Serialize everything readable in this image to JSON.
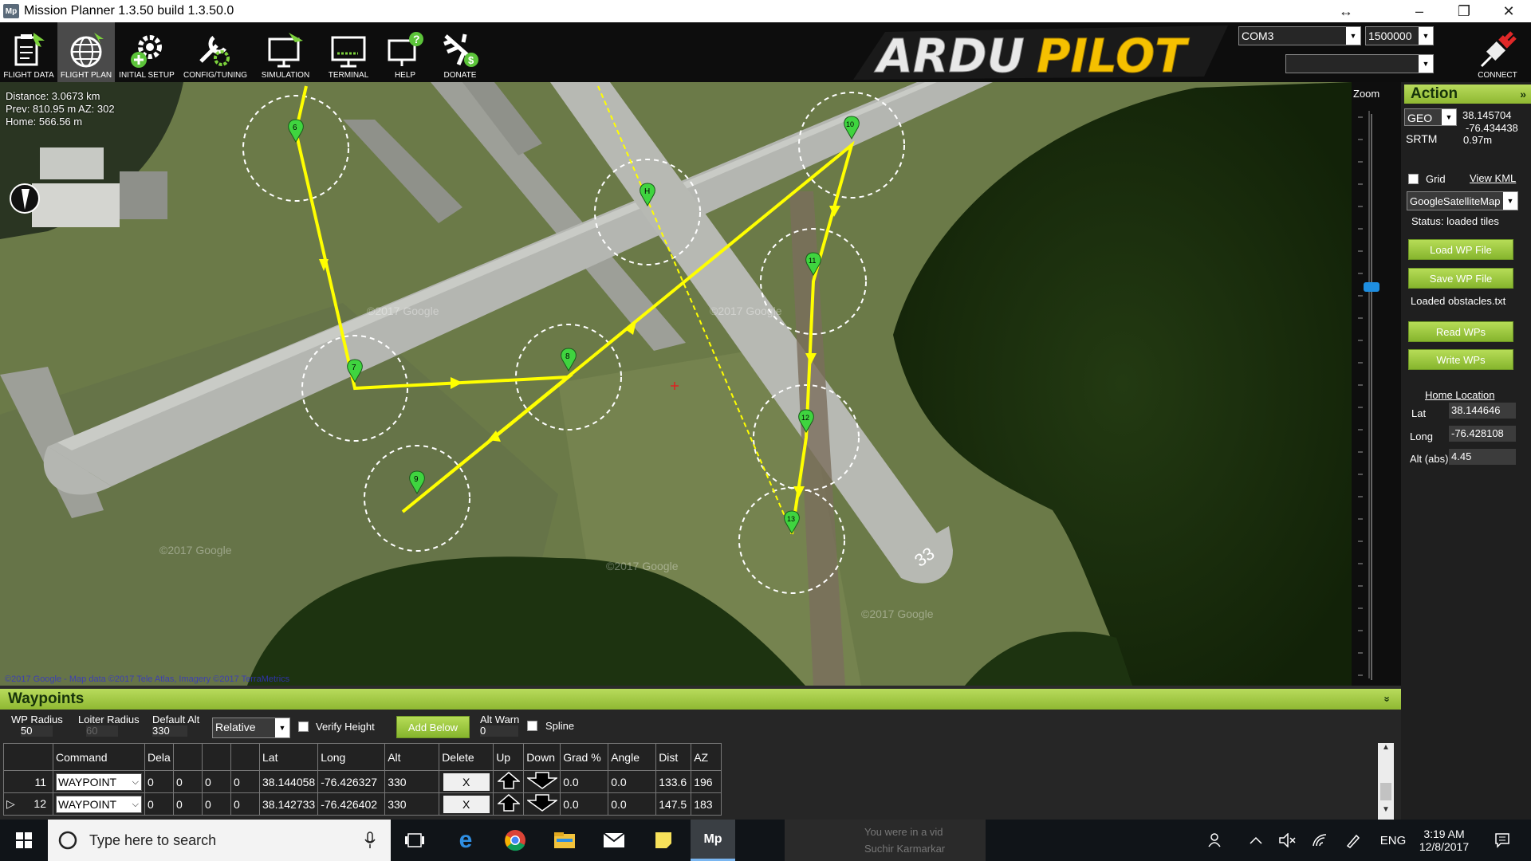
{
  "window": {
    "title": "Mission Planner 1.3.50 build 1.3.50.0",
    "app_icon": "Mp",
    "resize_glyph": "↔",
    "minimize": "–",
    "restore": "❐",
    "close": "✕"
  },
  "toolbar": {
    "buttons": [
      {
        "label": "FLIGHT DATA",
        "icon": "clipboard-plane-icon"
      },
      {
        "label": "FLIGHT PLAN",
        "icon": "globe-icon"
      },
      {
        "label": "INITIAL SETUP",
        "icon": "gear-plus-icon"
      },
      {
        "label": "CONFIG/TUNING",
        "icon": "wrench-gear-icon"
      },
      {
        "label": "SIMULATION",
        "icon": "monitor-plane-icon"
      },
      {
        "label": "TERMINAL",
        "icon": "terminal-icon"
      },
      {
        "label": "HELP",
        "icon": "monitor-question-icon"
      },
      {
        "label": "DONATE",
        "icon": "plane-dollar-icon"
      }
    ],
    "logo_left": "ARDU",
    "logo_right": "PILOT",
    "com_port": "COM3",
    "baud": "1500000",
    "connect_label": "CONNECT"
  },
  "map": {
    "distance": "Distance: 3.0673 km",
    "prev": "Prev: 810.95 m AZ: 302",
    "home": "Home: 566.56 m",
    "copyright": "©2017 Google - Map data ©2017 Tele Atlas, Imagery ©2017 TerraMetrics",
    "watermark": "©2017 Google",
    "runway_number": "33",
    "waypoint_labels": [
      "6",
      "7",
      "8",
      "9",
      "10",
      "11",
      "12",
      "13"
    ],
    "zoom_label": "Zoom"
  },
  "action_panel": {
    "title": "Action",
    "collapse_glyph": "»",
    "coord_mode": "GEO",
    "lat": "38.145704",
    "lng": "-76.434438",
    "srtm_label": "SRTM",
    "srtm_value": "0.97m",
    "grid_label": "Grid",
    "view_kml": "View KML",
    "map_provider": "GoogleSatelliteMap",
    "status": "Status: loaded tiles",
    "load_wp": "Load WP File",
    "save_wp": "Save WP File",
    "obstacles": "Loaded obstacles.txt",
    "read_wps": "Read WPs",
    "write_wps": "Write WPs",
    "home_location": "Home Location",
    "home_lat_label": "Lat",
    "home_lat": "38.144646",
    "home_long_label": "Long",
    "home_long": "-76.428108",
    "home_alt_label": "Alt (abs)",
    "home_alt": "4.45"
  },
  "waypoints": {
    "title": "Waypoints",
    "collapse_glyph": "»",
    "wp_radius_label": "WP Radius",
    "wp_radius": "50",
    "loiter_radius_label": "Loiter Radius",
    "loiter_radius": "60",
    "default_alt_label": "Default Alt",
    "default_alt": "330",
    "alt_mode": "Relative",
    "verify_height": "Verify Height",
    "add_below": "Add Below",
    "alt_warn_label": "Alt Warn",
    "alt_warn": "0",
    "spline": "Spline",
    "columns": [
      "",
      "Command",
      "Dela",
      "",
      "",
      "",
      "Lat",
      "Long",
      "Alt",
      "Delete",
      "Up",
      "Down",
      "Grad %",
      "Angle",
      "Dist",
      "AZ"
    ],
    "rows": [
      {
        "marker": "",
        "num": "11",
        "command": "WAYPOINT",
        "p1": "0",
        "p2": "0",
        "p3": "0",
        "p4": "0",
        "lat": "38.144058",
        "long": "-76.426327",
        "alt": "330",
        "delete": "X",
        "grad": "0.0",
        "angle": "0.0",
        "dist": "133.6",
        "az": "196"
      },
      {
        "marker": "▷",
        "num": "12",
        "command": "WAYPOINT",
        "p1": "0",
        "p2": "0",
        "p3": "0",
        "p4": "0",
        "lat": "38.142733",
        "long": "-76.426402",
        "alt": "330",
        "delete": "X",
        "grad": "0.0",
        "angle": "0.0",
        "dist": "147.5",
        "az": "183"
      }
    ]
  },
  "taskbar": {
    "search_placeholder": "Type here to search",
    "notification_line1": "You were in a vid",
    "notification_line2": "Suchir Karmarkar",
    "language": "ENG",
    "time": "3:19 AM",
    "date": "12/8/2017"
  },
  "colors": {
    "accent_green": "#9ec744",
    "path_yellow": "#ffff00",
    "logo_orange": "#f5c000",
    "waypoint_green": "#3fd43f"
  }
}
